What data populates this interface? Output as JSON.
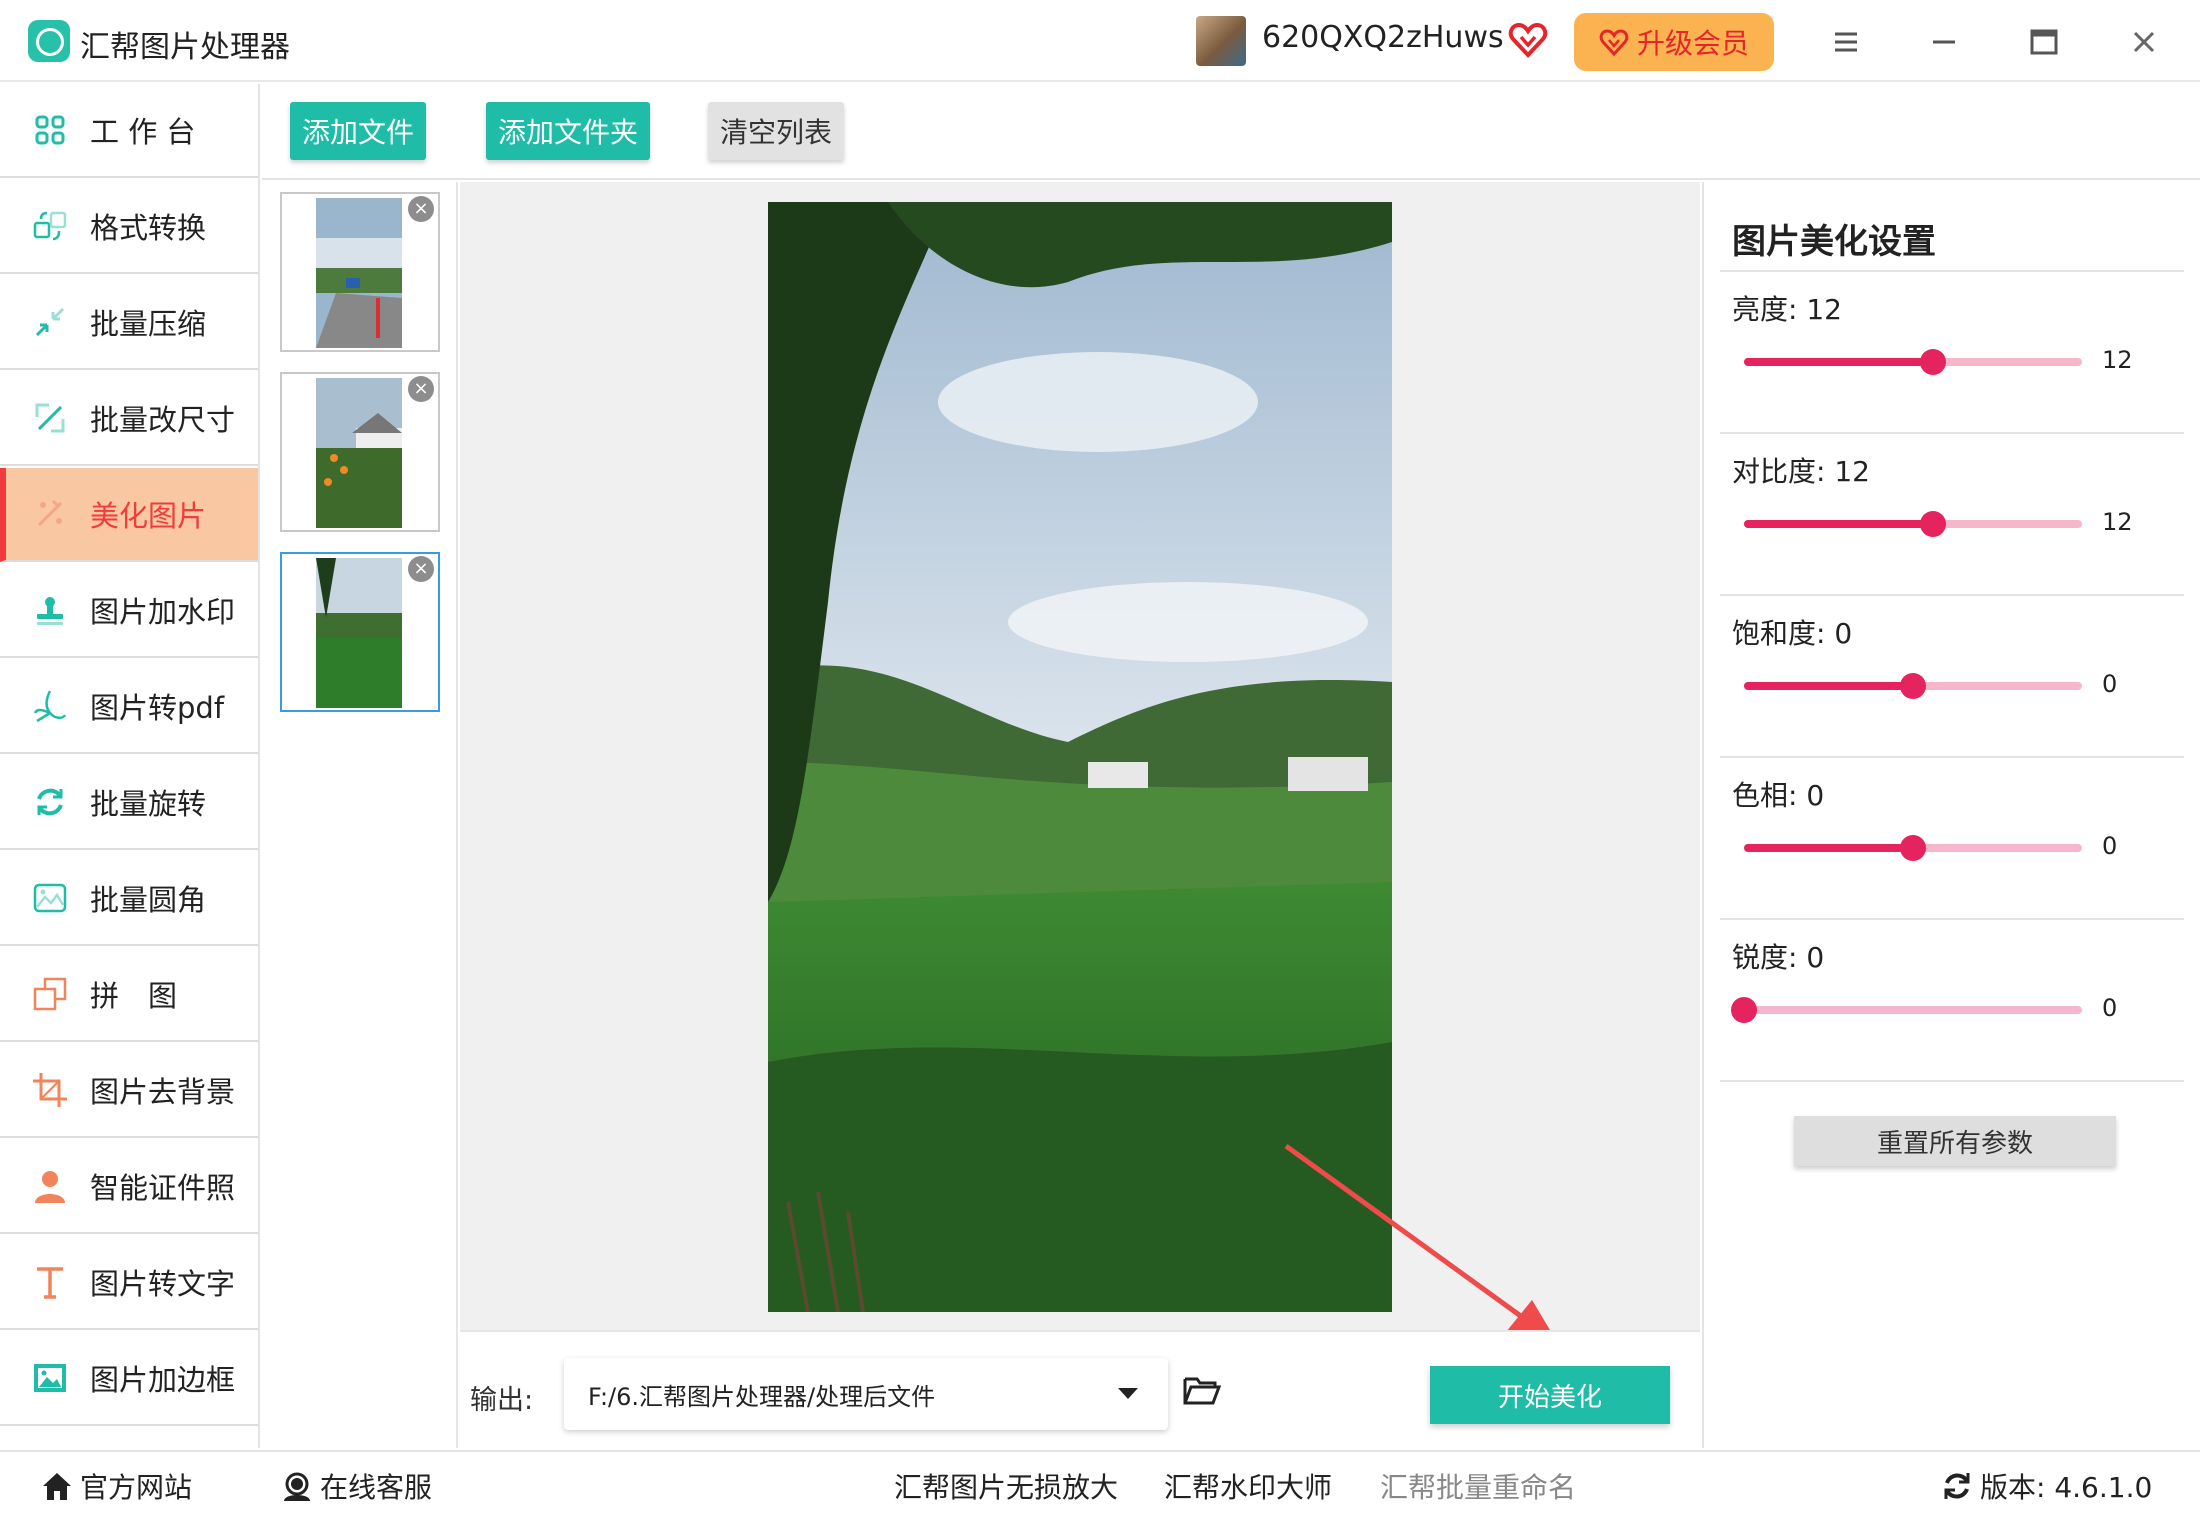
{
  "app": {
    "title": "汇帮图片处理器"
  },
  "user": {
    "name": "620QXQ2zHuws"
  },
  "header": {
    "upgrade_label": "升级会员"
  },
  "sidebar": {
    "items": [
      {
        "label": "工 作 台",
        "icon": "grid-icon"
      },
      {
        "label": "格式转换",
        "icon": "convert-icon"
      },
      {
        "label": "批量压缩",
        "icon": "compress-icon"
      },
      {
        "label": "批量改尺寸",
        "icon": "resize-icon"
      },
      {
        "label": "美化图片",
        "icon": "beautify-icon"
      },
      {
        "label": "图片加水印",
        "icon": "watermark-icon"
      },
      {
        "label": "图片转pdf",
        "icon": "pdf-icon"
      },
      {
        "label": "批量旋转",
        "icon": "rotate-icon"
      },
      {
        "label": "批量圆角",
        "icon": "round-corner-icon"
      },
      {
        "label": "拼　图",
        "icon": "collage-icon"
      },
      {
        "label": "图片去背景",
        "icon": "crop-icon"
      },
      {
        "label": "智能证件照",
        "icon": "person-icon"
      },
      {
        "label": "图片转文字",
        "icon": "text-icon"
      },
      {
        "label": "图片加边框",
        "icon": "frame-icon"
      }
    ]
  },
  "toolbar": {
    "add_file": "添加文件",
    "add_folder": "添加文件夹",
    "clear_list": "清空列表"
  },
  "thumbnails": {
    "count": 3,
    "selected_index": 2
  },
  "output": {
    "label": "输出:",
    "path": "F:/6.汇帮图片处理器/处理后文件",
    "start_label": "开始美化"
  },
  "settings": {
    "title": "图片美化设置",
    "params": [
      {
        "label": "亮度: 12",
        "value": "12",
        "fraction": 0.56
      },
      {
        "label": "对比度: 12",
        "value": "12",
        "fraction": 0.56
      },
      {
        "label": "饱和度: 0",
        "value": "0",
        "fraction": 0.5
      },
      {
        "label": "色相: 0",
        "value": "0",
        "fraction": 0.5
      },
      {
        "label": "锐度: 0",
        "value": "0",
        "fraction": 0.0
      }
    ],
    "reset_label": "重置所有参数"
  },
  "footer": {
    "website": "官方网站",
    "support": "在线客服",
    "link1": "汇帮图片无损放大",
    "link2": "汇帮水印大师",
    "link3": "汇帮批量重命名",
    "version": "版本:  4.6.1.0"
  },
  "colors": {
    "accent": "#1fbca7",
    "active_bg": "#f9c8a2",
    "active_text": "#f03c3c",
    "slider": "#e5245f",
    "upgrade": "#fbb352"
  }
}
